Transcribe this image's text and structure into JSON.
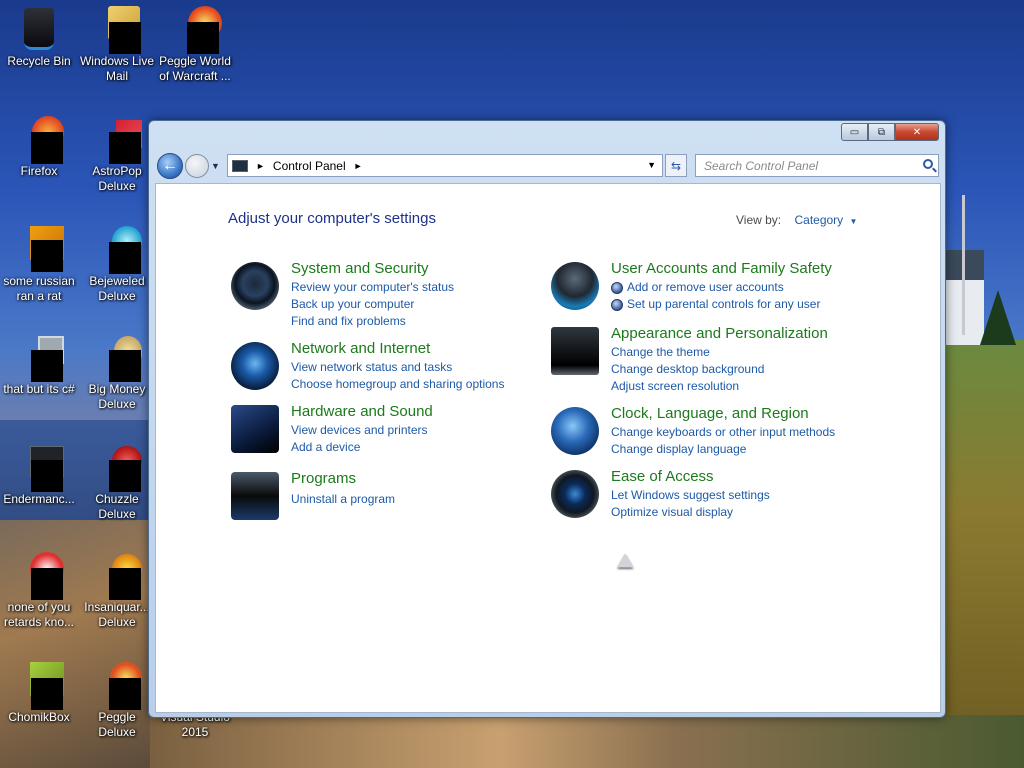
{
  "desktop": {
    "icons": [
      {
        "label": "Recycle Bin",
        "icon": "recycle-bin-icon"
      },
      {
        "label": "Windows Live Mail",
        "icon": "windows-live-mail-icon"
      },
      {
        "label": "Peggle World of Warcraft ...",
        "icon": "peggle-wow-icon"
      },
      {
        "label": "Firefox",
        "icon": "firefox-icon"
      },
      {
        "label": "AstroPop Deluxe",
        "icon": "astropop-icon"
      },
      {
        "label": "some russian ran a rat",
        "icon": "game-icon"
      },
      {
        "label": "Bejeweled Deluxe",
        "icon": "bejeweled-icon"
      },
      {
        "label": "that but its c#",
        "icon": "shortcut-icon"
      },
      {
        "label": "Big Money Deluxe",
        "icon": "big-money-icon"
      },
      {
        "label": "Endermanc...",
        "icon": "program-icon"
      },
      {
        "label": "Chuzzle Deluxe",
        "icon": "chuzzle-icon"
      },
      {
        "label": "none of you retards kno...",
        "icon": "shortcut-icon"
      },
      {
        "label": "Insaniquar... Deluxe",
        "icon": "insaniquarium-icon"
      },
      {
        "label": "ChomikBox",
        "icon": "chomikbox-icon"
      },
      {
        "label": "Peggle Deluxe",
        "icon": "peggle-icon"
      },
      {
        "label": "Visual Studio 2015",
        "icon": "visual-studio-icon"
      }
    ]
  },
  "window": {
    "title_buttons": {
      "minimize": "▭",
      "maximize": "⧉",
      "close": "✕"
    },
    "address": {
      "path": "Control Panel",
      "separator": "►"
    },
    "search": {
      "placeholder": "Search Control Panel"
    }
  },
  "content": {
    "heading": "Adjust your computer's settings",
    "view_by_label": "View by:",
    "view_by_value": "Category",
    "categories": [
      {
        "title": "System and Security",
        "icon": "security-icon",
        "links": [
          "Review your computer's status",
          "Back up your computer",
          "Find and fix problems"
        ]
      },
      {
        "title": "Network and Internet",
        "icon": "network-icon",
        "links": [
          "View network status and tasks",
          "Choose homegroup and sharing options"
        ]
      },
      {
        "title": "Hardware and Sound",
        "icon": "hardware-icon",
        "links": [
          "View devices and printers",
          "Add a device"
        ]
      },
      {
        "title": "Programs",
        "icon": "programs-icon",
        "links": [
          "Uninstall a program"
        ]
      },
      {
        "title": "User Accounts and Family Safety",
        "icon": "users-icon",
        "links": [
          "Add or remove user accounts",
          "Set up parental controls for any user"
        ]
      },
      {
        "title": "Appearance and Personalization",
        "icon": "appearance-icon",
        "links": [
          "Change the theme",
          "Change desktop background",
          "Adjust screen resolution"
        ]
      },
      {
        "title": "Clock, Language, and Region",
        "icon": "clock-icon",
        "links": [
          "Change keyboards or other input methods",
          "Change display language"
        ]
      },
      {
        "title": "Ease of Access",
        "icon": "ease-of-access-icon",
        "links": [
          "Let Windows suggest settings",
          "Optimize visual display"
        ]
      }
    ]
  }
}
